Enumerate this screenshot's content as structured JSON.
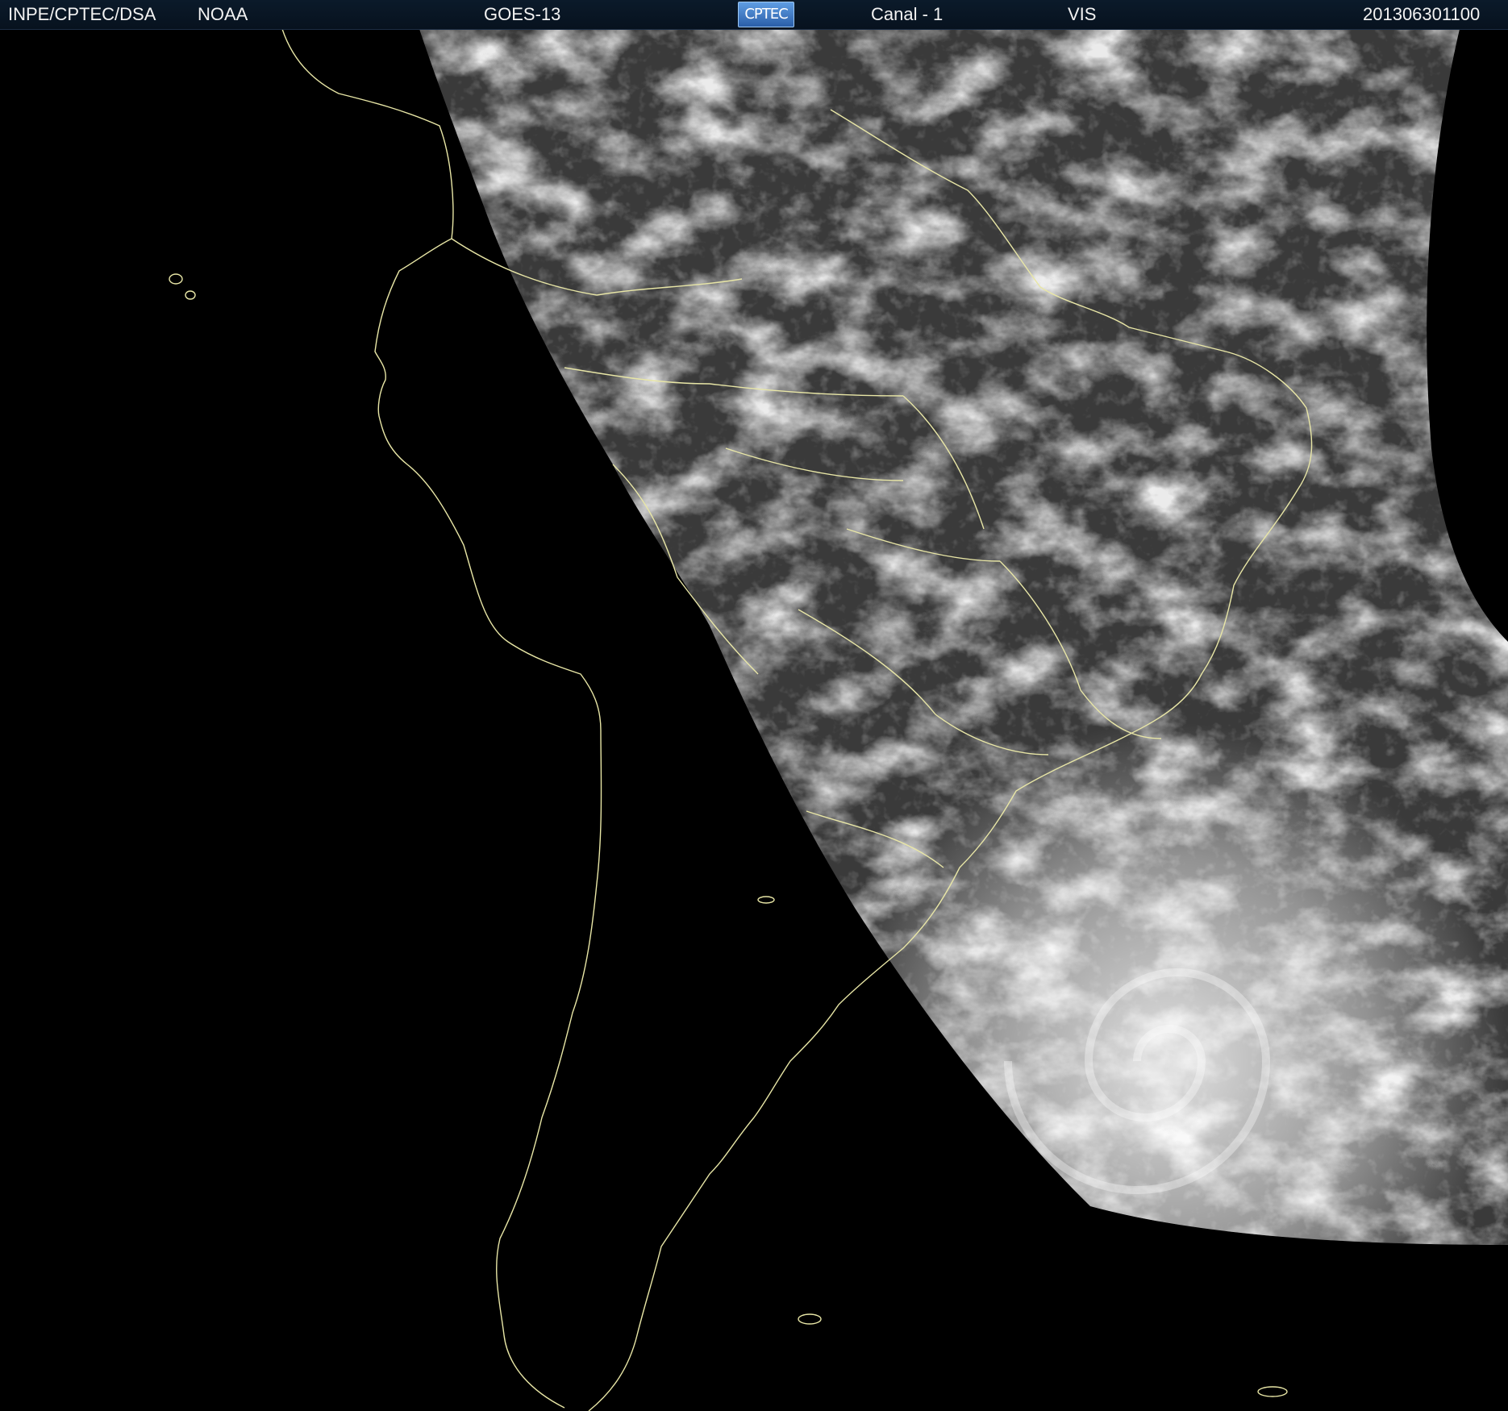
{
  "header": {
    "agency": "INPE/CPTEC/DSA",
    "provider": "NOAA",
    "satellite": "GOES-13",
    "logo_text": "CPTEC",
    "channel": "Canal - 1",
    "band": "VIS",
    "timestamp": "201306301100"
  },
  "colors": {
    "header_bg": "#0b1a2a",
    "header_text": "#f2f2f2",
    "coastline": "#e8e6a6",
    "space": "#000000",
    "cloud": "#f4f4f4",
    "surface": "#3d3d3d"
  }
}
